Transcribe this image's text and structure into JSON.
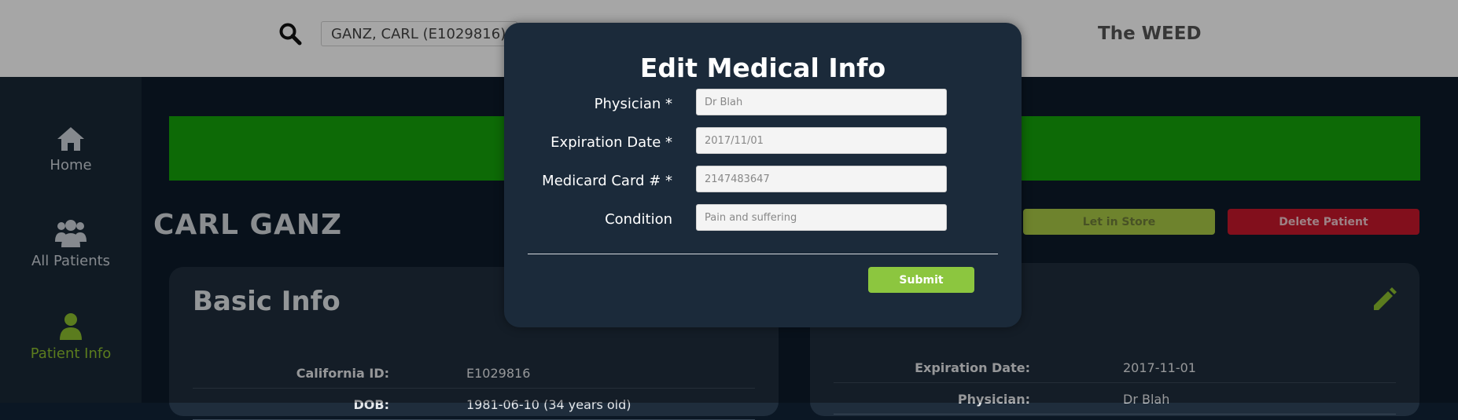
{
  "header": {
    "search_value": "GANZ, CARL (E1029816)",
    "brand": "The WEED"
  },
  "sidebar": {
    "items": [
      {
        "label": "Home",
        "icon": "home-icon"
      },
      {
        "label": "All Patients",
        "icon": "users-icon"
      },
      {
        "label": "Patient Info",
        "icon": "user-icon",
        "active": true
      }
    ]
  },
  "patient": {
    "name": "CARL GANZ",
    "let_in_label": "Let in Store",
    "delete_label": "Delete Patient"
  },
  "basic_info": {
    "title": "Basic Info",
    "rows": [
      {
        "key": "California ID:",
        "value": "E1029816"
      },
      {
        "key": "DOB:",
        "value": "1981-06-10 (34 years old)"
      }
    ]
  },
  "medical_info": {
    "rows": [
      {
        "key": "Expiration Date:",
        "value": "2017-11-01"
      },
      {
        "key": "Physician:",
        "value": "Dr Blah"
      }
    ]
  },
  "modal": {
    "title": "Edit Medical Info",
    "fields": [
      {
        "label": "Physician *",
        "value": "Dr Blah"
      },
      {
        "label": "Expiration Date *",
        "value": "2017/11/01"
      },
      {
        "label": "Medicard Card # *",
        "value": "2147483647"
      },
      {
        "label": "Condition",
        "value": "Pain and suffering"
      }
    ],
    "submit_label": "Submit"
  },
  "colors": {
    "accent_green": "#8cc63f",
    "banner_green": "#14a40a",
    "danger_red": "#c8182c",
    "modal_bg": "#1b2a3a"
  }
}
